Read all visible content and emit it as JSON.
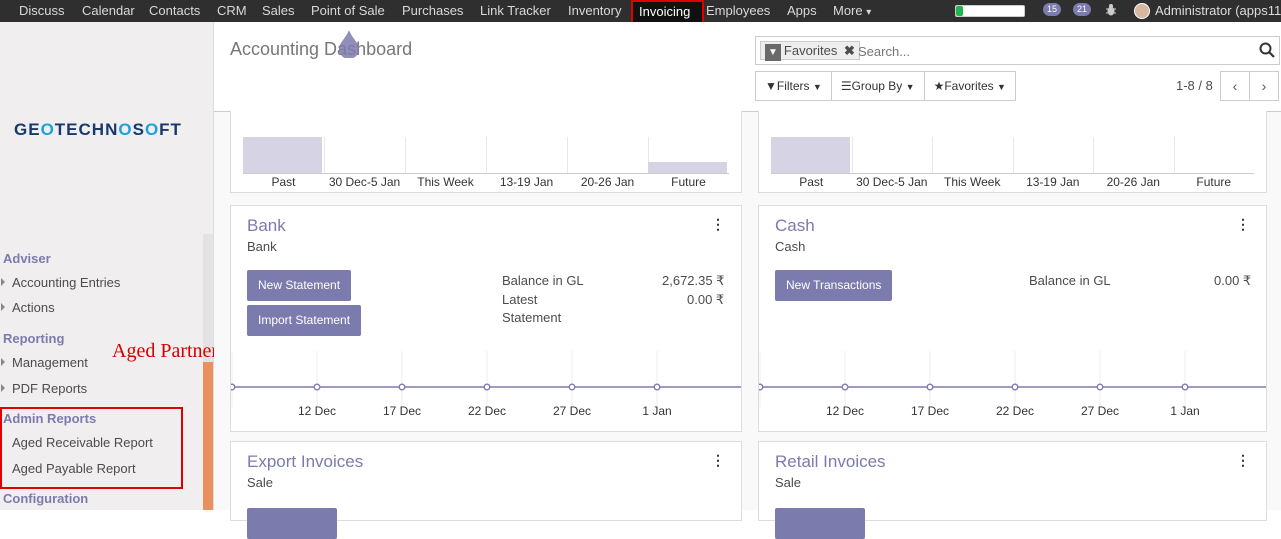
{
  "topbar": {
    "apps": [
      "Discuss",
      "Calendar",
      "Contacts",
      "CRM",
      "Sales",
      "Point of Sale",
      "Purchases",
      "Link Tracker",
      "Inventory",
      "Invoicing",
      "Employees",
      "Apps",
      "More"
    ],
    "active": "Invoicing",
    "more_caret": "▾",
    "messages_count": "15",
    "activities_count": "21",
    "user": "Administrator (apps11",
    "progress": 0.1
  },
  "sidebar": {
    "logo": "GEOTECHNOSOFT",
    "sections": [
      {
        "title": "Adviser",
        "items": [
          "Accounting Entries",
          "Actions"
        ]
      },
      {
        "title": "Reporting",
        "items": [
          "Management",
          "PDF Reports"
        ]
      },
      {
        "title": "Admin Reports",
        "items": [
          "Aged Receivable Report",
          "Aged Payable Report"
        ]
      },
      {
        "title": "Configuration",
        "items": []
      }
    ],
    "annotation": "Aged Partner Report Menu"
  },
  "control_panel": {
    "title": "Accounting Dashboard",
    "facet": "Favorites",
    "search_placeholder": "Search...",
    "filters": "Filters",
    "group_by": "Group By",
    "favorites": "Favorites",
    "pager": "1-8 / 8"
  },
  "top_charts": [
    {
      "labels": [
        "Past",
        "30 Dec-5 Jan",
        "This Week",
        "13-19 Jan",
        "20-26 Jan",
        "Future"
      ],
      "values": [
        1.0,
        0,
        0,
        0,
        0,
        0.3
      ]
    },
    {
      "labels": [
        "Past",
        "30 Dec-5 Jan",
        "This Week",
        "13-19 Jan",
        "20-26 Jan",
        "Future"
      ],
      "values": [
        1.0,
        0,
        0,
        0,
        0,
        0
      ]
    }
  ],
  "cards": [
    {
      "title": "Bank",
      "subtitle": "Bank",
      "buttons": [
        "New Statement",
        "Import Statement"
      ],
      "balance_label": "Balance in GL",
      "balance_value": "2,672.35 ₹",
      "latest_label_1": "Latest",
      "latest_label_2": "Statement",
      "latest_value": "0.00 ₹",
      "timeline": [
        "12 Dec",
        "17 Dec",
        "22 Dec",
        "27 Dec",
        "1 Jan"
      ]
    },
    {
      "title": "Cash",
      "subtitle": "Cash",
      "buttons": [
        "New Transactions"
      ],
      "balance_label": "Balance in GL",
      "balance_value": "0.00 ₹",
      "timeline": [
        "12 Dec",
        "17 Dec",
        "22 Dec",
        "27 Dec",
        "1 Jan"
      ]
    },
    {
      "title": "Export Invoices",
      "subtitle": "Sale"
    },
    {
      "title": "Retail Invoices",
      "subtitle": "Sale"
    }
  ]
}
